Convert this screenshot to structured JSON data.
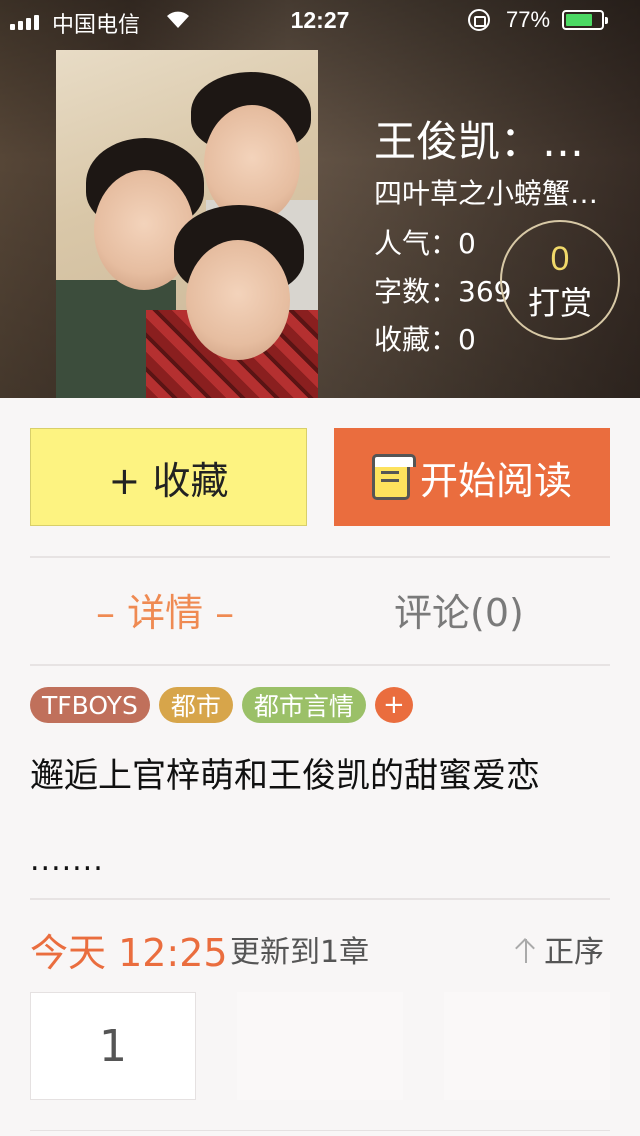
{
  "status_bar": {
    "carrier": "中国电信",
    "time": "12:27",
    "battery_percent": "77%",
    "battery_level": 0.77
  },
  "book": {
    "title": "王俊凯：…",
    "author": "四叶草之小螃蟹…",
    "popularity": "人气：0",
    "word_count": "字数：369",
    "favorites": "收藏：0"
  },
  "tip": {
    "count": "0",
    "label": "打赏"
  },
  "actions": {
    "favorite_label": "+ 收藏",
    "read_label": "开始阅读"
  },
  "tabs": [
    {
      "label": "– 详情 –",
      "active": true
    },
    {
      "label": "评论(0)",
      "active": false
    }
  ],
  "tags": [
    "TFBOYS",
    "都市",
    "都市言情"
  ],
  "tag_add": "+",
  "description": "邂逅上官梓萌和王俊凯的甜蜜爱恋",
  "description_more": ".......",
  "update": {
    "time": "今天 12:25",
    "text": "更新到1章",
    "sort_label": "正序"
  },
  "chapters": [
    "1",
    "",
    ""
  ],
  "colors": {
    "accent": "#ea6d3e",
    "favorite_bg": "#fdf381",
    "tab_active": "#ef8a52"
  }
}
